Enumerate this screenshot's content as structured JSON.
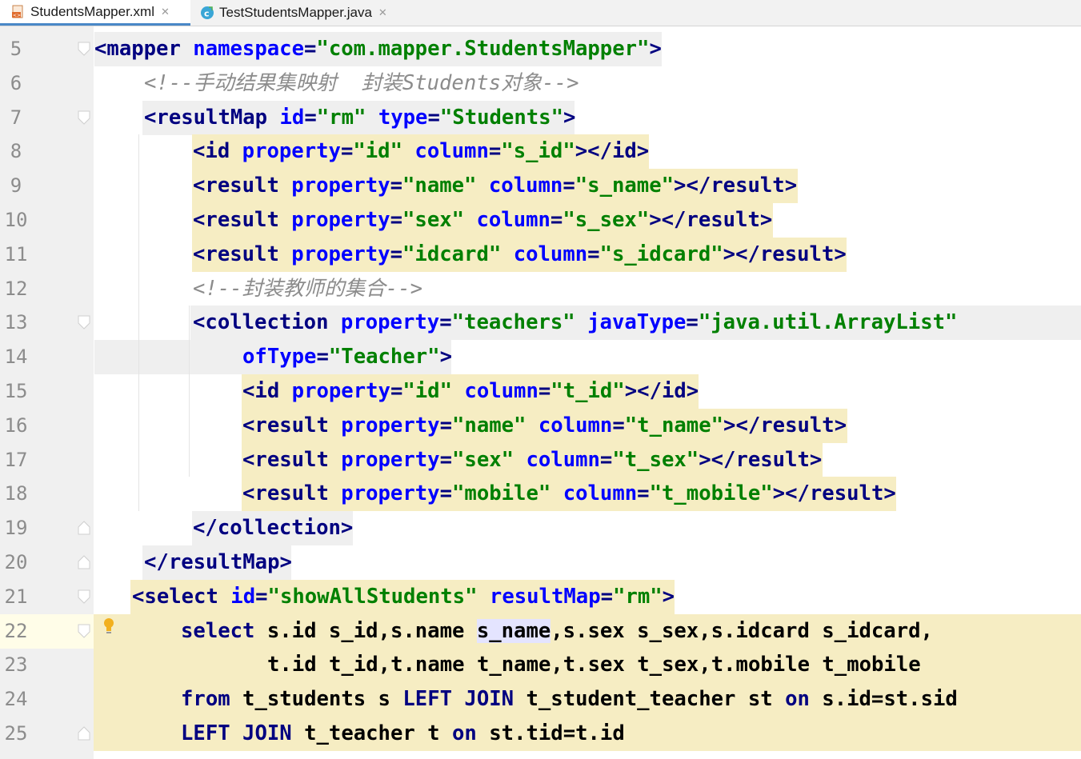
{
  "tabs": [
    {
      "label": "StudentsMapper.xml",
      "icon": "xml-file-icon",
      "active": true
    },
    {
      "label": "TestStudentsMapper.java",
      "icon": "java-class-icon",
      "active": false
    }
  ],
  "colors": {
    "xml_tag": "#000080",
    "xml_attr": "#0000ff",
    "xml_value": "#008000",
    "comment": "#8c8c8c",
    "tag_highlight": "#f6edc3",
    "gutter": "#f0f0f0"
  },
  "lines": [
    {
      "n": "5",
      "tokens": [
        {
          "t": "<mapper",
          "c": "t"
        },
        {
          "t": " ",
          "c": "p"
        },
        {
          "t": "namespace",
          "c": "a"
        },
        {
          "t": "=",
          "c": "t"
        },
        {
          "t": "\"com.mapper.StudentsMapper\"",
          "c": "v"
        },
        {
          "t": ">",
          "c": "t"
        }
      ]
    },
    {
      "n": "6",
      "tokens": [
        {
          "t": "<!--手动结果集映射  封装Students对象-->",
          "c": "c"
        }
      ]
    },
    {
      "n": "7",
      "tokens": [
        {
          "t": "<resultMap",
          "c": "t"
        },
        {
          "t": " ",
          "c": "p"
        },
        {
          "t": "id",
          "c": "a"
        },
        {
          "t": "=",
          "c": "t"
        },
        {
          "t": "\"rm\"",
          "c": "v"
        },
        {
          "t": " ",
          "c": "p"
        },
        {
          "t": "type",
          "c": "a"
        },
        {
          "t": "=",
          "c": "t"
        },
        {
          "t": "\"Students\"",
          "c": "v"
        },
        {
          "t": ">",
          "c": "t"
        }
      ]
    },
    {
      "n": "8",
      "tokens": [
        {
          "t": "<id",
          "c": "t"
        },
        {
          "t": " ",
          "c": "p"
        },
        {
          "t": "property",
          "c": "a"
        },
        {
          "t": "=",
          "c": "t"
        },
        {
          "t": "\"id\"",
          "c": "v"
        },
        {
          "t": " ",
          "c": "p"
        },
        {
          "t": "column",
          "c": "a"
        },
        {
          "t": "=",
          "c": "t"
        },
        {
          "t": "\"s_id\"",
          "c": "v"
        },
        {
          "t": "></id>",
          "c": "t"
        }
      ]
    },
    {
      "n": "9",
      "tokens": [
        {
          "t": "<result",
          "c": "t"
        },
        {
          "t": " ",
          "c": "p"
        },
        {
          "t": "property",
          "c": "a"
        },
        {
          "t": "=",
          "c": "t"
        },
        {
          "t": "\"name\"",
          "c": "v"
        },
        {
          "t": " ",
          "c": "p"
        },
        {
          "t": "column",
          "c": "a"
        },
        {
          "t": "=",
          "c": "t"
        },
        {
          "t": "\"s_name\"",
          "c": "v"
        },
        {
          "t": "></result>",
          "c": "t"
        }
      ]
    },
    {
      "n": "10",
      "tokens": [
        {
          "t": "<result",
          "c": "t"
        },
        {
          "t": " ",
          "c": "p"
        },
        {
          "t": "property",
          "c": "a"
        },
        {
          "t": "=",
          "c": "t"
        },
        {
          "t": "\"sex\"",
          "c": "v"
        },
        {
          "t": " ",
          "c": "p"
        },
        {
          "t": "column",
          "c": "a"
        },
        {
          "t": "=",
          "c": "t"
        },
        {
          "t": "\"s_sex\"",
          "c": "v"
        },
        {
          "t": "></result>",
          "c": "t"
        }
      ]
    },
    {
      "n": "11",
      "tokens": [
        {
          "t": "<result",
          "c": "t"
        },
        {
          "t": " ",
          "c": "p"
        },
        {
          "t": "property",
          "c": "a"
        },
        {
          "t": "=",
          "c": "t"
        },
        {
          "t": "\"idcard\"",
          "c": "v"
        },
        {
          "t": " ",
          "c": "p"
        },
        {
          "t": "column",
          "c": "a"
        },
        {
          "t": "=",
          "c": "t"
        },
        {
          "t": "\"s_idcard\"",
          "c": "v"
        },
        {
          "t": "></result>",
          "c": "t"
        }
      ]
    },
    {
      "n": "12",
      "tokens": [
        {
          "t": "<!--封装教师的集合-->",
          "c": "c"
        }
      ]
    },
    {
      "n": "13",
      "tokens": [
        {
          "t": "<collection",
          "c": "t"
        },
        {
          "t": " ",
          "c": "p"
        },
        {
          "t": "property",
          "c": "a"
        },
        {
          "t": "=",
          "c": "t"
        },
        {
          "t": "\"teachers\"",
          "c": "v"
        },
        {
          "t": " ",
          "c": "p"
        },
        {
          "t": "javaType",
          "c": "a"
        },
        {
          "t": "=",
          "c": "t"
        },
        {
          "t": "\"java.util.ArrayList\"",
          "c": "v"
        }
      ]
    },
    {
      "n": "14",
      "tokens": [
        {
          "t": "ofType",
          "c": "a"
        },
        {
          "t": "=",
          "c": "t"
        },
        {
          "t": "\"Teacher\"",
          "c": "v"
        },
        {
          "t": ">",
          "c": "t"
        }
      ]
    },
    {
      "n": "15",
      "tokens": [
        {
          "t": "<id",
          "c": "t"
        },
        {
          "t": " ",
          "c": "p"
        },
        {
          "t": "property",
          "c": "a"
        },
        {
          "t": "=",
          "c": "t"
        },
        {
          "t": "\"id\"",
          "c": "v"
        },
        {
          "t": " ",
          "c": "p"
        },
        {
          "t": "column",
          "c": "a"
        },
        {
          "t": "=",
          "c": "t"
        },
        {
          "t": "\"t_id\"",
          "c": "v"
        },
        {
          "t": "></id>",
          "c": "t"
        }
      ]
    },
    {
      "n": "16",
      "tokens": [
        {
          "t": "<result",
          "c": "t"
        },
        {
          "t": " ",
          "c": "p"
        },
        {
          "t": "property",
          "c": "a"
        },
        {
          "t": "=",
          "c": "t"
        },
        {
          "t": "\"name\"",
          "c": "v"
        },
        {
          "t": " ",
          "c": "p"
        },
        {
          "t": "column",
          "c": "a"
        },
        {
          "t": "=",
          "c": "t"
        },
        {
          "t": "\"t_name\"",
          "c": "v"
        },
        {
          "t": "></result>",
          "c": "t"
        }
      ]
    },
    {
      "n": "17",
      "tokens": [
        {
          "t": "<result",
          "c": "t"
        },
        {
          "t": " ",
          "c": "p"
        },
        {
          "t": "property",
          "c": "a"
        },
        {
          "t": "=",
          "c": "t"
        },
        {
          "t": "\"sex\"",
          "c": "v"
        },
        {
          "t": " ",
          "c": "p"
        },
        {
          "t": "column",
          "c": "a"
        },
        {
          "t": "=",
          "c": "t"
        },
        {
          "t": "\"t_sex\"",
          "c": "v"
        },
        {
          "t": "></result>",
          "c": "t"
        }
      ]
    },
    {
      "n": "18",
      "tokens": [
        {
          "t": "<result",
          "c": "t"
        },
        {
          "t": " ",
          "c": "p"
        },
        {
          "t": "property",
          "c": "a"
        },
        {
          "t": "=",
          "c": "t"
        },
        {
          "t": "\"mobile\"",
          "c": "v"
        },
        {
          "t": " ",
          "c": "p"
        },
        {
          "t": "column",
          "c": "a"
        },
        {
          "t": "=",
          "c": "t"
        },
        {
          "t": "\"t_mobile\"",
          "c": "v"
        },
        {
          "t": "></result>",
          "c": "t"
        }
      ]
    },
    {
      "n": "19",
      "tokens": [
        {
          "t": "</collection>",
          "c": "t"
        }
      ]
    },
    {
      "n": "20",
      "tokens": [
        {
          "t": "</resultMap>",
          "c": "t"
        }
      ]
    },
    {
      "n": "21",
      "tokens": [
        {
          "t": "<select",
          "c": "t"
        },
        {
          "t": " ",
          "c": "p"
        },
        {
          "t": "id",
          "c": "a"
        },
        {
          "t": "=",
          "c": "t"
        },
        {
          "t": "\"showAllStudents\"",
          "c": "v"
        },
        {
          "t": " ",
          "c": "p"
        },
        {
          "t": "resultMap",
          "c": "a"
        },
        {
          "t": "=",
          "c": "t"
        },
        {
          "t": "\"rm\"",
          "c": "v"
        },
        {
          "t": ">",
          "c": "t"
        }
      ]
    },
    {
      "n": "22",
      "tokens": [
        {
          "t": "select",
          "c": "kw"
        },
        {
          "t": " s.id s_id,s.name ",
          "c": "p"
        },
        {
          "t": "s_name",
          "c": "sel"
        },
        {
          "t": ",s.sex s_sex,s.idcard s_idcard,",
          "c": "p"
        }
      ]
    },
    {
      "n": "23",
      "tokens": [
        {
          "t": "t.id t_id,t.name t_name,t.sex t_sex,t.mobile t_mobile",
          "c": "p"
        }
      ]
    },
    {
      "n": "24",
      "tokens": [
        {
          "t": "from",
          "c": "kw"
        },
        {
          "t": " t_students s ",
          "c": "p"
        },
        {
          "t": "LEFT JOIN",
          "c": "kw"
        },
        {
          "t": " t_student_teacher st ",
          "c": "p"
        },
        {
          "t": "on",
          "c": "kw"
        },
        {
          "t": " s.id=st.sid",
          "c": "p"
        }
      ]
    },
    {
      "n": "25",
      "tokens": [
        {
          "t": "LEFT JOIN",
          "c": "kw"
        },
        {
          "t": " t_teacher t ",
          "c": "p"
        },
        {
          "t": "on",
          "c": "kw"
        },
        {
          "t": " st.tid=t.id",
          "c": "p"
        }
      ]
    }
  ]
}
